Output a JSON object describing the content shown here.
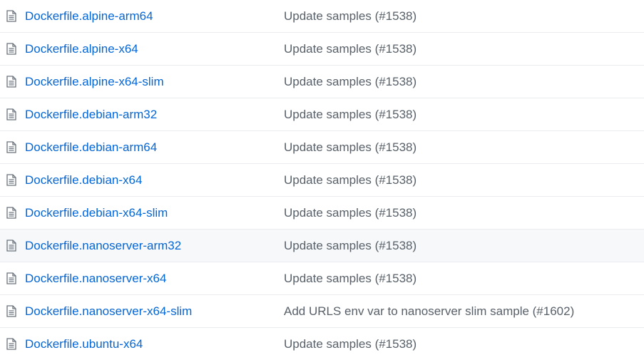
{
  "colors": {
    "link": "#0366d6",
    "message": "#586069",
    "icon": "#6a737d",
    "row_border": "#eaecef",
    "row_hover": "#f6f8fa"
  },
  "files": {
    "rows": [
      {
        "icon": "file-icon",
        "name": "Dockerfile.alpine-arm64",
        "message": "Update samples (#1538)"
      },
      {
        "icon": "file-icon",
        "name": "Dockerfile.alpine-x64",
        "message": "Update samples (#1538)"
      },
      {
        "icon": "file-icon",
        "name": "Dockerfile.alpine-x64-slim",
        "message": "Update samples (#1538)"
      },
      {
        "icon": "file-icon",
        "name": "Dockerfile.debian-arm32",
        "message": "Update samples (#1538)"
      },
      {
        "icon": "file-icon",
        "name": "Dockerfile.debian-arm64",
        "message": "Update samples (#1538)"
      },
      {
        "icon": "file-icon",
        "name": "Dockerfile.debian-x64",
        "message": "Update samples (#1538)"
      },
      {
        "icon": "file-icon",
        "name": "Dockerfile.debian-x64-slim",
        "message": "Update samples (#1538)"
      },
      {
        "icon": "file-icon",
        "name": "Dockerfile.nanoserver-arm32",
        "message": "Update samples (#1538)"
      },
      {
        "icon": "file-icon",
        "name": "Dockerfile.nanoserver-x64",
        "message": "Update samples (#1538)"
      },
      {
        "icon": "file-icon",
        "name": "Dockerfile.nanoserver-x64-slim",
        "message": "Add URLS env var to nanoserver slim sample (#1602)"
      },
      {
        "icon": "file-icon",
        "name": "Dockerfile.ubuntu-x64",
        "message": "Update samples (#1538)"
      }
    ]
  }
}
